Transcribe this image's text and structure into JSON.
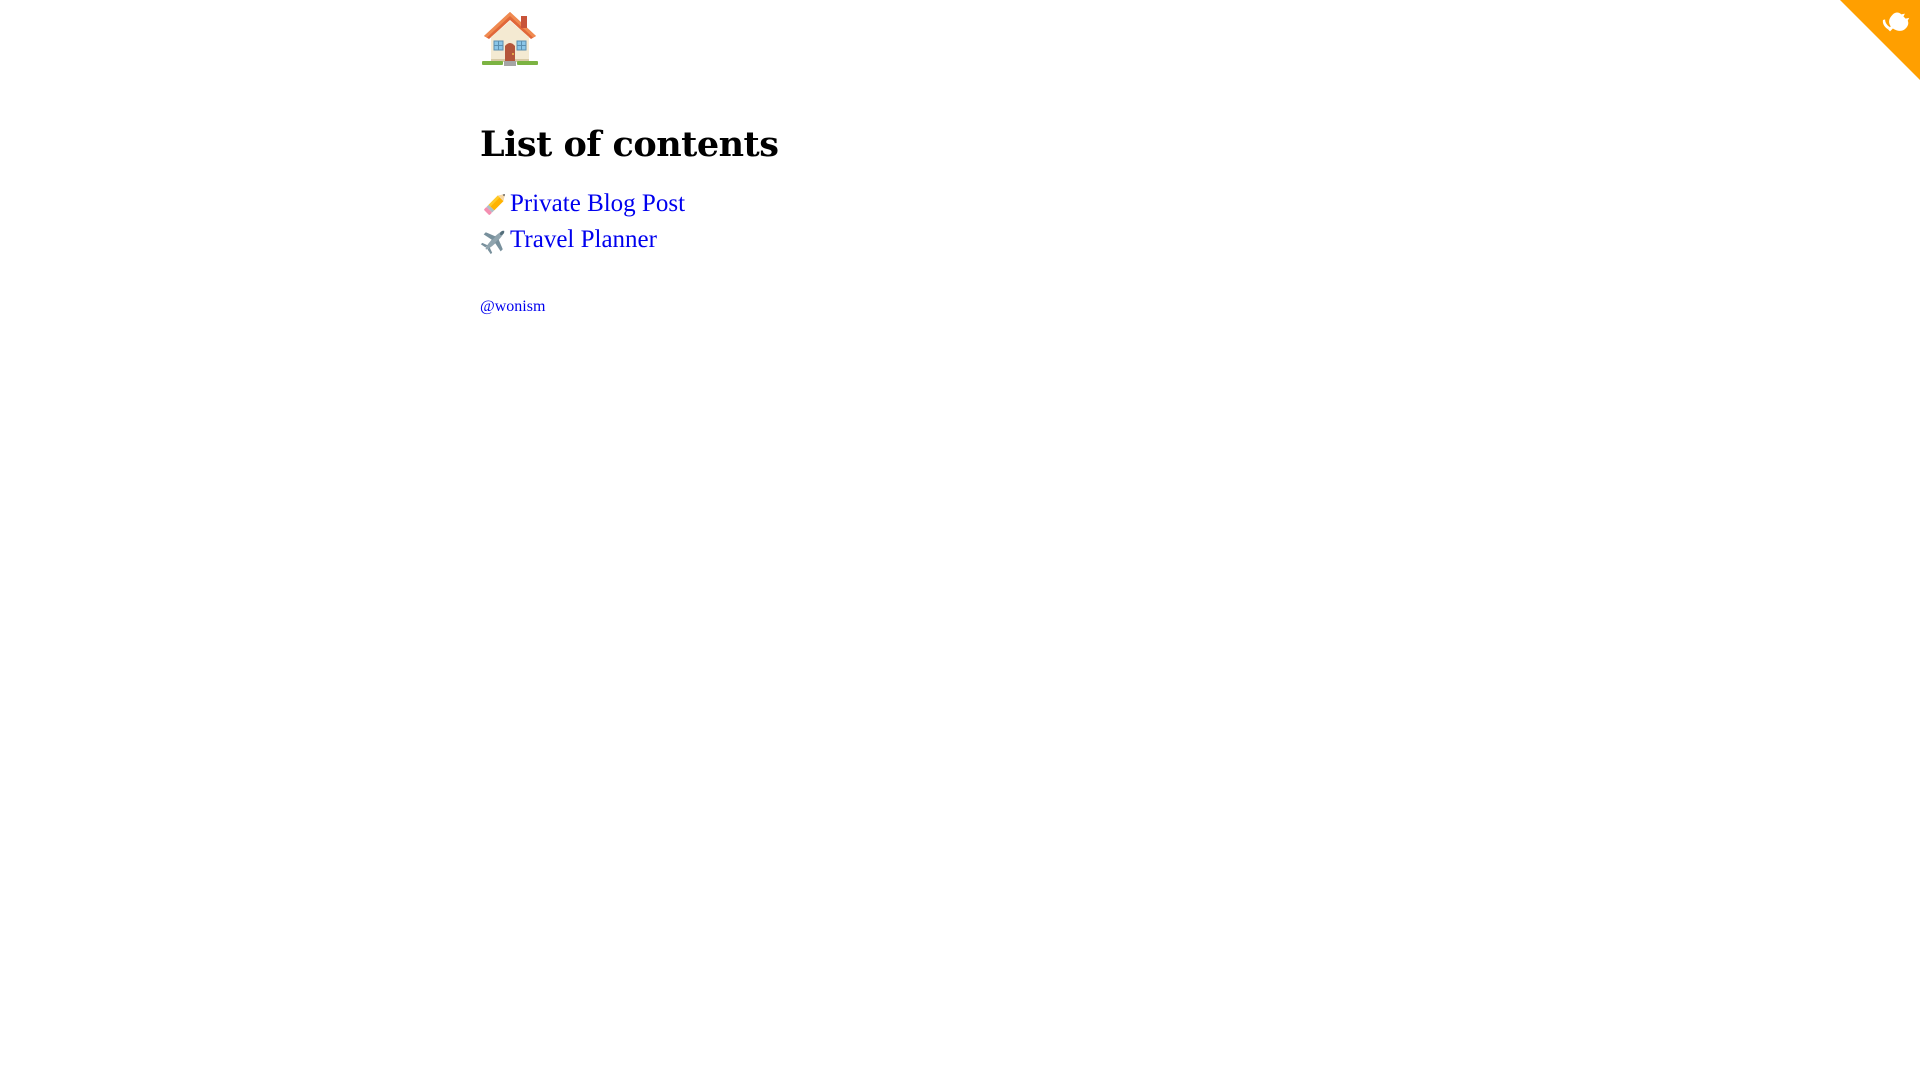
{
  "header": {
    "home_icon": "house-icon"
  },
  "main": {
    "title": "List of contents",
    "items": [
      {
        "icon": "pencil-icon",
        "label": "Private Blog Post"
      },
      {
        "icon": "airplane-icon",
        "label": "Travel Planner"
      }
    ]
  },
  "footer": {
    "author": "@wonism"
  },
  "corner": {
    "icon": "github-octocat-icon"
  },
  "colors": {
    "link": "#0000ee",
    "ribbon": "#ff9f00",
    "title": "#000000"
  }
}
